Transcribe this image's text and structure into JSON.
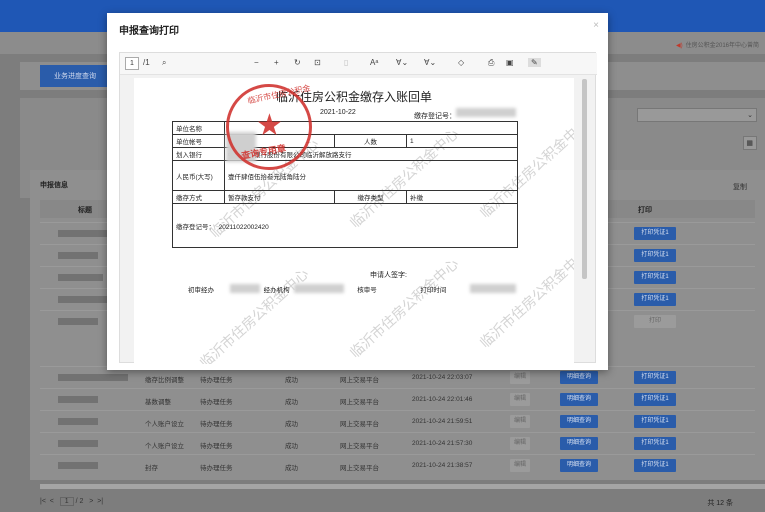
{
  "header": {
    "notice": "住房公积金2016年中心曾简"
  },
  "tabs": {
    "active": "业务进度查询"
  },
  "list": {
    "title": "申报信息",
    "copy_label": "复制",
    "columns": {
      "title": "标题",
      "print": "打印"
    },
    "print_label": "打印凭证1",
    "print_disabled_label": "打印",
    "edit_label": "编辑",
    "detail_label": "明细查询",
    "rows": [
      {
        "type": "缴存比例调整",
        "status": "待办理任务",
        "result": "成功",
        "channel": "网上交易平台",
        "time": "2021-10-24 22:03:07"
      },
      {
        "type": "基数调整",
        "status": "待办理任务",
        "result": "成功",
        "channel": "网上交易平台",
        "time": "2021-10-24 22:01:46"
      },
      {
        "type": "个人账户设立",
        "status": "待办理任务",
        "result": "成功",
        "channel": "网上交易平台",
        "time": "2021-10-24 21:59:51"
      },
      {
        "type": "个人账户设立",
        "status": "待办理任务",
        "result": "成功",
        "channel": "网上交易平台",
        "time": "2021-10-24 21:57:30"
      },
      {
        "type": "封存",
        "status": "待办理任务",
        "result": "成功",
        "channel": "网上交易平台",
        "time": "2021-10-24 21:38:57"
      }
    ],
    "pager": {
      "current": "1",
      "total_pages": "/ 2"
    },
    "total": "共 12 条"
  },
  "modal": {
    "title": "申报查询打印",
    "close": "×",
    "toolbar": {
      "page": "1",
      "page_total": "/1"
    },
    "document": {
      "title": "临沂住房公积金缴存入账回单",
      "date": "2021-10-22",
      "reg_label": "缴存登记号：",
      "unit_name_label": "单位名称",
      "unit_account_label": "单位帐号",
      "people_label": "人数",
      "people_value": "1",
      "bank_label": "划入银行",
      "bank_value": "中国建设银行股份有限公司临沂解放路支行",
      "amount_label": "人民币(大写)",
      "amount_value": "壹仟肆佰伍拾叁元陆角陆分",
      "method_label": "缴存方式",
      "method_value": "暂存款支付",
      "kind_label": "缴存类型",
      "kind_value": "补缴",
      "reg_no_label": "缴存登记号：",
      "reg_no_value": "20211022002420",
      "applicant_label": "申请人签字:",
      "footer_first": "初审经办",
      "footer_org": "经办机构",
      "footer_reviewer": "核审号",
      "footer_print_time": "打印时间",
      "stamp_text": "查询专用章",
      "stamp_arc": "临沂市住房公积金",
      "watermark": "临沂市住房公积金中心"
    }
  }
}
